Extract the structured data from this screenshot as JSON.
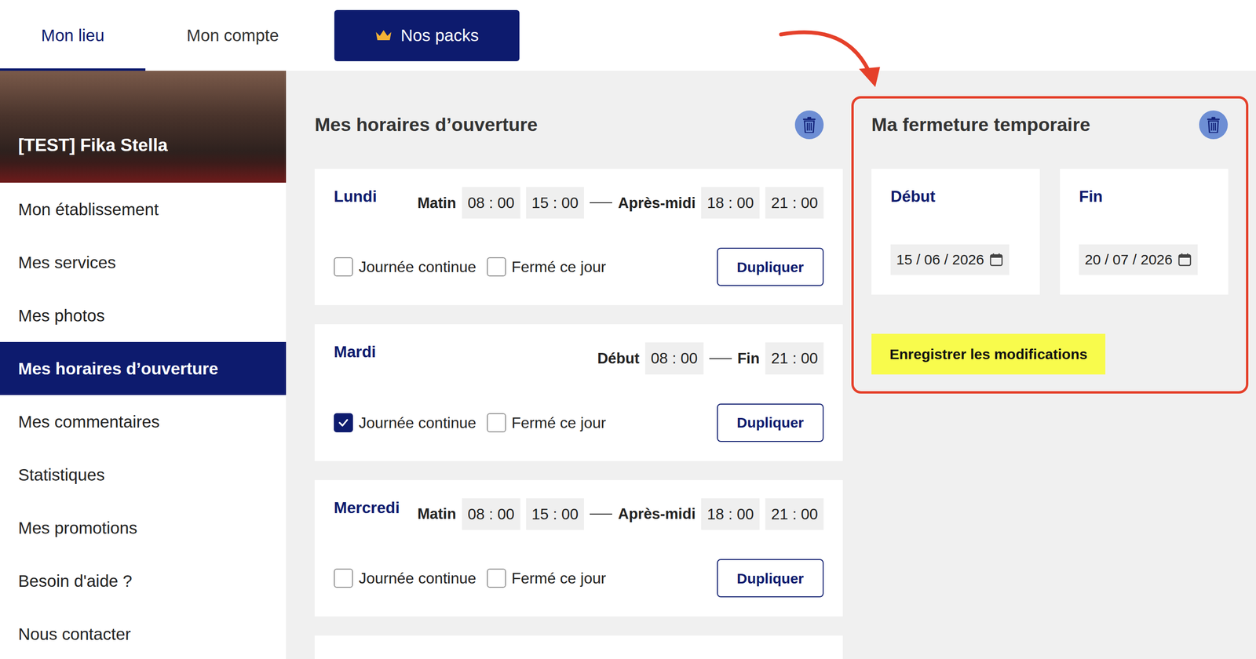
{
  "top_nav": {
    "tabs": [
      {
        "label": "Mon lieu",
        "selected": true
      },
      {
        "label": "Mon compte",
        "selected": false
      }
    ],
    "packs_button": "Nos packs"
  },
  "venue": {
    "name": "[TEST] Fika Stella"
  },
  "sidebar": {
    "items": [
      {
        "label": "Mon établissement",
        "selected": false
      },
      {
        "label": "Mes services",
        "selected": false
      },
      {
        "label": "Mes photos",
        "selected": false
      },
      {
        "label": "Mes horaires d’ouverture",
        "selected": true
      },
      {
        "label": "Mes commentaires",
        "selected": false
      },
      {
        "label": "Statistiques",
        "selected": false
      },
      {
        "label": "Mes promotions",
        "selected": false
      },
      {
        "label": "Besoin d'aide ?",
        "selected": false
      },
      {
        "label": "Nous contacter",
        "selected": false
      }
    ]
  },
  "hours": {
    "title": "Mes horaires d’ouverture",
    "days": [
      {
        "name": "Lundi",
        "slots": [
          {
            "label": "Matin",
            "times": [
              "08 : 00",
              "15 : 00"
            ]
          },
          {
            "label": "Après-midi",
            "times": [
              "18 : 00",
              "21 : 00"
            ]
          }
        ],
        "continuous": {
          "label": "Journée continue",
          "checked": false
        },
        "closed": {
          "label": "Fermé ce jour",
          "checked": false
        },
        "button": "Dupliquer"
      },
      {
        "name": "Mardi",
        "slots": [
          {
            "label": "Début",
            "times": [
              "08 : 00"
            ]
          },
          {
            "label": "Fin",
            "times": [
              "21 : 00"
            ]
          }
        ],
        "continuous": {
          "label": "Journée continue",
          "checked": true
        },
        "closed": {
          "label": "Fermé ce jour",
          "checked": false
        },
        "button": "Dupliquer"
      },
      {
        "name": "Mercredi",
        "slots": [
          {
            "label": "Matin",
            "times": [
              "08 : 00",
              "15 : 00"
            ]
          },
          {
            "label": "Après-midi",
            "times": [
              "18 : 00",
              "21 : 00"
            ]
          }
        ],
        "continuous": {
          "label": "Journée continue",
          "checked": false
        },
        "closed": {
          "label": "Fermé ce jour",
          "checked": false
        },
        "button": "Dupliquer"
      }
    ]
  },
  "closure": {
    "title": "Ma fermeture temporaire",
    "fields": [
      {
        "label": "Début",
        "value": "15 / 06 / 2026"
      },
      {
        "label": "Fin",
        "value": "20 / 07 / 2026"
      }
    ],
    "save_button": "Enregistrer les modifications"
  }
}
